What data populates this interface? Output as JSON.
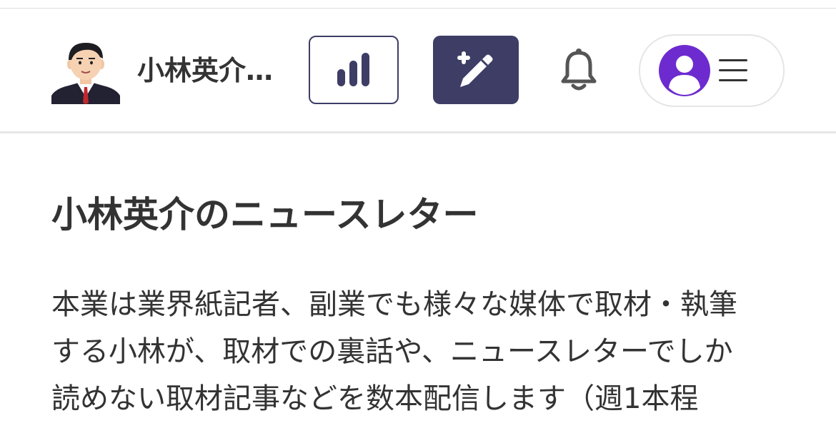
{
  "header": {
    "author_name": "小林英介…",
    "icons": {
      "avatar": "author-avatar",
      "stats": "bar-chart-icon",
      "write": "magic-pen-icon",
      "notifications": "bell-icon",
      "profile": "user-circle-icon",
      "menu": "hamburger-menu-icon"
    }
  },
  "colors": {
    "primary": "#3d3d66",
    "profile_purple": "#6d2bcf",
    "text": "#333333",
    "border": "#e5e5e5"
  },
  "main": {
    "title": "小林英介のニュースレター",
    "description_lines": [
      "本業は業界紙記者、副業でも様々な媒体で取材・執筆",
      "する小林が、取材での裏話や、ニュースレターでしか",
      "読めない取材記事などを数本配信します（週1本程"
    ]
  }
}
